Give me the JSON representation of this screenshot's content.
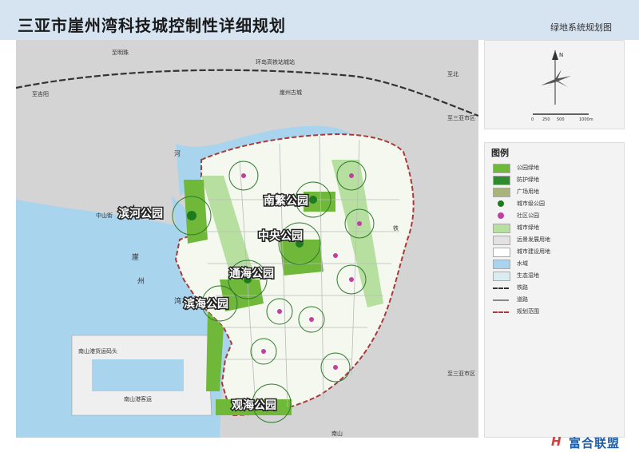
{
  "header": {
    "title": "三亚市崖州湾科技城控制性详细规划",
    "subtitle": "绿地系统规划图"
  },
  "map": {
    "parks": [
      {
        "name": "南繁公园"
      },
      {
        "name": "滨河公园"
      },
      {
        "name": "中央公园"
      },
      {
        "name": "通海公园"
      },
      {
        "name": "滨海公园"
      },
      {
        "name": "观海公园"
      }
    ],
    "place_labels": {
      "zhijie": "至明珠",
      "jiyang": "至吉阳",
      "railway": "环岛高铁站城站",
      "yazhou_old": "崖州古城",
      "yazhou_east": "至三亚市区",
      "yazhou_east2": "至三亚市区",
      "zhongshan": "中山街",
      "port": "南山港货运码头",
      "port2": "南山港客运",
      "nanshan": "南山",
      "zhibei": "至北",
      "yazhou_bay": "崖",
      "zhou": "州",
      "wan": "湾",
      "river": "河",
      "tie": "铁"
    }
  },
  "compass": {
    "north": "N",
    "scale_labels": [
      "0",
      "250",
      "500",
      "1000m"
    ]
  },
  "legend": {
    "title": "图例",
    "items": [
      {
        "label": "公园绿地",
        "color": "#6fb83a"
      },
      {
        "label": "防护绿地",
        "color": "#2e8b2e"
      },
      {
        "label": "广场用地",
        "color": "#a9b47a"
      },
      {
        "label": "城市级公园",
        "color": "#1e7a1e"
      },
      {
        "label": "社区公园",
        "color": "#c040a0"
      },
      {
        "label": "城市绿地",
        "color": "#b7dfa0"
      },
      {
        "label": "远景发展用地",
        "color": "#e2e2e2"
      },
      {
        "label": "城市建设用地",
        "color": "#ffffff"
      },
      {
        "label": "水域",
        "color": "#a9d4ee"
      },
      {
        "label": "生态湿地",
        "color": "#d8ecf2"
      },
      {
        "label": "铁路",
        "color": "#333333"
      },
      {
        "label": "道路",
        "color": "#888888"
      },
      {
        "label": "规划范围",
        "color": "#a83a3a"
      }
    ]
  },
  "brand": {
    "mark": "H",
    "text": "富合联盟"
  }
}
